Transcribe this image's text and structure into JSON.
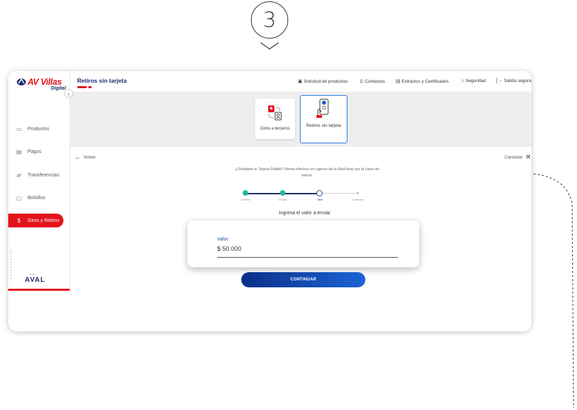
{
  "step_number": "3",
  "app": {
    "logo_brand": "AV Villas",
    "logo_sub": "Digital",
    "page_title": "Retiros sin tarjeta",
    "footer_logo": "AVAL",
    "footer_logo_sub": "Grupo"
  },
  "header_nav": [
    {
      "label": "Solicitud de productos",
      "icon": "document-icon"
    },
    {
      "label": "Contactos",
      "icon": "user-icon"
    },
    {
      "label": "Extractos y Certificados",
      "icon": "file-icon"
    },
    {
      "label": "Seguridad",
      "icon": "lock-icon"
    },
    {
      "label": "Salida segura",
      "icon": "logout-icon"
    }
  ],
  "sidebar": {
    "items": [
      {
        "label": "Productos",
        "icon": "wallet-icon"
      },
      {
        "label": "Pagos",
        "icon": "card-icon"
      },
      {
        "label": "Transferencias",
        "icon": "transfer-icon"
      },
      {
        "label": "Bolsillos",
        "icon": "pocket-icon"
      },
      {
        "label": "Giros y Retiros",
        "icon": "cash-icon",
        "active": true
      }
    ]
  },
  "cards": [
    {
      "label": "Giros a terceros"
    },
    {
      "label": "Retiros sin tarjeta",
      "selected": true
    }
  ],
  "back_label": "Volver",
  "cancel_label": "Cancelar",
  "hint_text": "¿Olvidaste tu Tarjeta Débito? Retira efectivo en cajeros de la Red Aval con la clave de retiros.",
  "stepper": {
    "steps": [
      "Cuenta",
      "Celular",
      "Valor",
      "Confirma"
    ],
    "current": 3
  },
  "section_title": "Ingresa el valor a enviar",
  "value_field": {
    "label": "Valor",
    "value": "$ 50.000"
  },
  "continue_label": "CONTINUAR",
  "colors": {
    "brand_red": "#e3131c",
    "brand_blue": "#1a2a6c",
    "button_blue": "#1c64d6",
    "step_green": "#1fb89a"
  }
}
